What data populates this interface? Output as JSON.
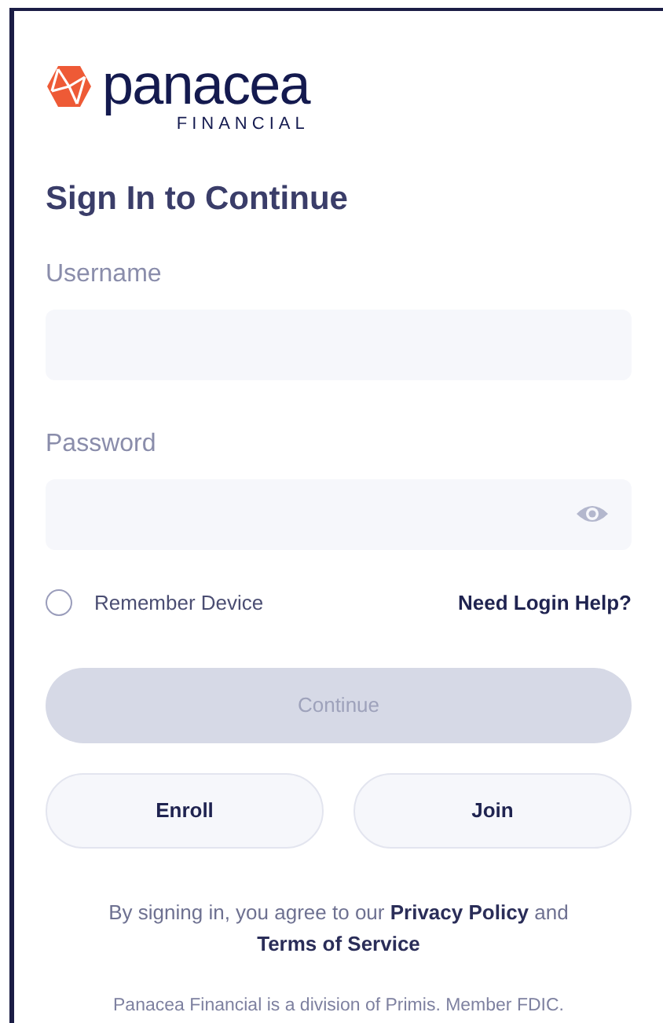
{
  "brand": {
    "name": "panacea",
    "sub": "FINANCIAL"
  },
  "heading": "Sign In to Continue",
  "fields": [
    {
      "label": "Username",
      "kind": "text"
    },
    {
      "label": "Password",
      "kind": "password"
    }
  ],
  "remember": {
    "label": "Remember Device",
    "checked": false
  },
  "help_link": "Need Login Help?",
  "continue": {
    "label": "Continue",
    "disabled": true
  },
  "secondary_buttons": [
    "Enroll",
    "Join"
  ],
  "terms": {
    "prefix": "By signing in, you agree to our",
    "privacy": "Privacy Policy",
    "middle": "and",
    "terms": "Terms of Service"
  },
  "footer": "Panacea Financial is a division of Primis. Member FDIC."
}
